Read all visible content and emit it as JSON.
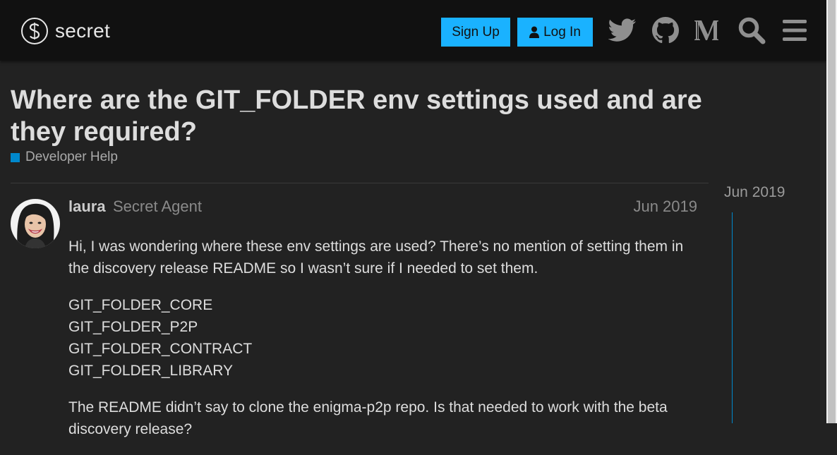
{
  "header": {
    "logo_text": "secret",
    "signup_label": "Sign Up",
    "login_label": "Log In",
    "icons": [
      "twitter-icon",
      "github-icon",
      "medium-icon",
      "search-icon",
      "hamburger-menu-icon"
    ]
  },
  "topic": {
    "title": "Where are the GIT_FOLDER env settings used and are they required?",
    "category": "Developer Help",
    "category_color": "#0088cc"
  },
  "post": {
    "username": "laura",
    "user_title": "Secret Agent",
    "date": "Jun 2019",
    "paragraph1": "Hi, I was wondering where these env settings are used? There’s no mention of setting them in the discovery release README so I wasn’t sure if I needed to set them.",
    "env_vars": [
      "GIT_FOLDER_CORE",
      "GIT_FOLDER_P2P",
      "GIT_FOLDER_CONTRACT",
      "GIT_FOLDER_LIBRARY"
    ],
    "paragraph2": "The README didn’t say to clone the enigma-p2p repo. Is that needed to work with the beta discovery release?"
  },
  "timeline": {
    "date": "Jun 2019"
  },
  "colors": {
    "accent": "#1ab2ff",
    "background": "#222222",
    "header_bg": "#111111"
  }
}
